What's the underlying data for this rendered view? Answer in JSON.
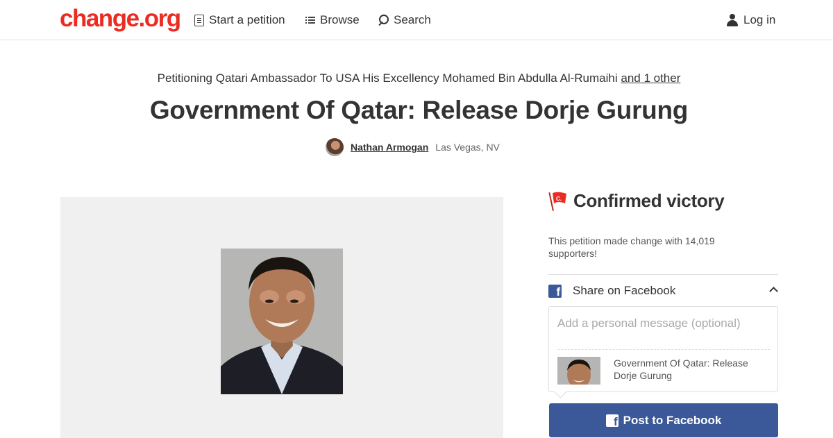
{
  "header": {
    "logo": "change.org",
    "nav": {
      "start_petition": "Start a petition",
      "browse": "Browse",
      "search": "Search",
      "login": "Log in"
    }
  },
  "petition": {
    "petitioning_prefix": "Petitioning Qatari Ambassador To USA His Excellency Mohamed Bin Abdulla Al-Rumaihi ",
    "and_others_link": "and 1 other",
    "title": "Government Of Qatar: Release Dorje Gurung",
    "author_name": "Nathan Armogan",
    "author_location": "Las Vegas, NV"
  },
  "sidebar": {
    "victory_label": "Confirmed victory",
    "made_change_text": "This petition made change with 14,019 supporters!",
    "supporters_count": 14019,
    "share_label": "Share on Facebook",
    "message_placeholder": "Add a personal message (optional)",
    "preview_title": "Government Of Qatar: Release Dorje Gurung",
    "post_button": "Post to Facebook",
    "fb_glyph": "f"
  },
  "colors": {
    "brand_red": "#ec2c22",
    "facebook_blue": "#3b5998",
    "text": "#333333",
    "media_bg": "#f0f0f0"
  },
  "icons": [
    "petition-icon",
    "browse-list-icon",
    "search-icon",
    "user-icon",
    "victory-flag-icon",
    "facebook-icon",
    "chevron-up-icon"
  ]
}
